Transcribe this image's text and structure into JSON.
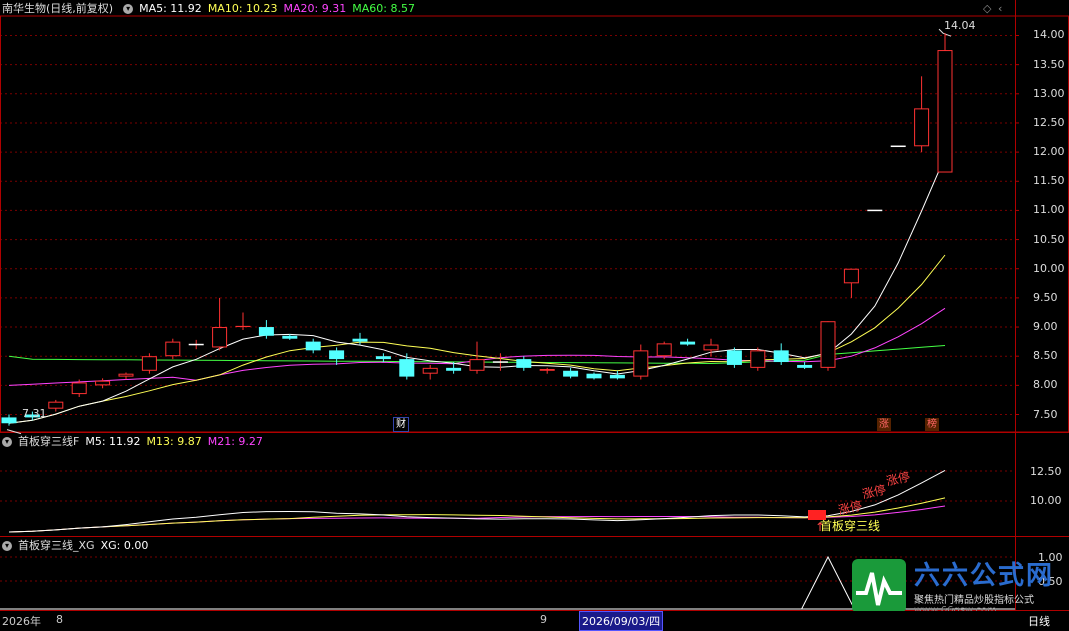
{
  "main_panel": {
    "stock_name": "南华生物(日线,前复权)",
    "indicators": [
      {
        "label": "MA5: 11.92",
        "color": "#ffffff"
      },
      {
        "label": "MA10: 10.23",
        "color": "#ffff55"
      },
      {
        "label": "MA20: 9.31",
        "color": "#ff44ff"
      },
      {
        "label": "MA60: 8.57",
        "color": "#44ff44"
      }
    ],
    "y_ticks": [
      "14.00",
      "13.50",
      "13.00",
      "12.50",
      "12.00",
      "11.50",
      "11.00",
      "10.50",
      "10.00",
      "9.50",
      "9.00",
      "8.50",
      "8.00",
      "7.50"
    ],
    "high_label": "14.04",
    "low_label": "7.31",
    "markers": [
      {
        "text": "财",
        "color": "#ffffff"
      },
      {
        "text": "涨",
        "color": "#ff6666"
      },
      {
        "text": "榜",
        "color": "#ff6666"
      }
    ]
  },
  "panel2": {
    "title": "首板穿三线F",
    "indicators": [
      {
        "label": "M5: 11.92",
        "color": "#ffffff"
      },
      {
        "label": "M13: 9.87",
        "color": "#ffff55"
      },
      {
        "label": "M21: 9.27",
        "color": "#ff44ff"
      }
    ],
    "y_ticks": [
      "12.50",
      "10.00"
    ],
    "annotations": [
      "涨停",
      "涨停",
      "涨停"
    ],
    "signal_label": "首板穿三线"
  },
  "panel3": {
    "title": "首板穿三线_XG",
    "indicators": [
      {
        "label": "XG: 0.00",
        "color": "#ffffff"
      }
    ],
    "y_ticks": [
      "1.00",
      "0.50"
    ]
  },
  "bottom": {
    "year": "2026年",
    "month1": "8",
    "month2": "9",
    "cursor_date": "2026/09/03/四",
    "period": "日线"
  },
  "logo": {
    "name": "六六公式网",
    "slogan": "聚焦热门精品炒股指标公式",
    "url": "www.66gsw.com"
  },
  "colors": {
    "up": "#ff3232",
    "down": "#54ffff",
    "grid": "#7a0000",
    "frame": "#b00000"
  },
  "chart_data": {
    "type": "candlestick",
    "ylim": [
      7.2,
      14.3
    ],
    "candles": [
      {
        "o": 7.45,
        "h": 7.5,
        "l": 7.31,
        "c": 7.35
      },
      {
        "o": 7.5,
        "h": 7.55,
        "l": 7.4,
        "c": 7.45
      },
      {
        "o": 7.6,
        "h": 7.75,
        "l": 7.55,
        "c": 7.72
      },
      {
        "o": 7.85,
        "h": 8.1,
        "l": 7.8,
        "c": 8.05
      },
      {
        "o": 8.0,
        "h": 8.12,
        "l": 7.95,
        "c": 8.08
      },
      {
        "o": 8.15,
        "h": 8.22,
        "l": 8.1,
        "c": 8.2
      },
      {
        "o": 8.25,
        "h": 8.55,
        "l": 8.2,
        "c": 8.5
      },
      {
        "o": 8.5,
        "h": 8.8,
        "l": 8.45,
        "c": 8.75
      },
      {
        "o": 8.7,
        "h": 8.78,
        "l": 8.62,
        "c": 8.7
      },
      {
        "o": 8.65,
        "h": 9.5,
        "l": 8.6,
        "c": 9.0
      },
      {
        "o": 9.0,
        "h": 9.25,
        "l": 8.95,
        "c": 9.02
      },
      {
        "o": 9.0,
        "h": 9.12,
        "l": 8.8,
        "c": 8.85
      },
      {
        "o": 8.85,
        "h": 8.88,
        "l": 8.78,
        "c": 8.8
      },
      {
        "o": 8.75,
        "h": 8.8,
        "l": 8.55,
        "c": 8.6
      },
      {
        "o": 8.6,
        "h": 8.65,
        "l": 8.35,
        "c": 8.45
      },
      {
        "o": 8.8,
        "h": 8.9,
        "l": 8.7,
        "c": 8.75
      },
      {
        "o": 8.5,
        "h": 8.55,
        "l": 8.4,
        "c": 8.45
      },
      {
        "o": 8.45,
        "h": 8.55,
        "l": 8.1,
        "c": 8.15
      },
      {
        "o": 8.2,
        "h": 8.35,
        "l": 8.1,
        "c": 8.3
      },
      {
        "o": 8.3,
        "h": 8.4,
        "l": 8.2,
        "c": 8.25
      },
      {
        "o": 8.25,
        "h": 8.75,
        "l": 8.2,
        "c": 8.45
      },
      {
        "o": 8.4,
        "h": 8.55,
        "l": 8.25,
        "c": 8.4
      },
      {
        "o": 8.45,
        "h": 8.5,
        "l": 8.25,
        "c": 8.3
      },
      {
        "o": 8.25,
        "h": 8.3,
        "l": 8.2,
        "c": 8.28
      },
      {
        "o": 8.25,
        "h": 8.3,
        "l": 8.12,
        "c": 8.15
      },
      {
        "o": 8.2,
        "h": 8.22,
        "l": 8.1,
        "c": 8.12
      },
      {
        "o": 8.18,
        "h": 8.25,
        "l": 8.1,
        "c": 8.12
      },
      {
        "o": 8.15,
        "h": 8.7,
        "l": 8.1,
        "c": 8.6
      },
      {
        "o": 8.5,
        "h": 8.75,
        "l": 8.45,
        "c": 8.72
      },
      {
        "o": 8.75,
        "h": 8.8,
        "l": 8.68,
        "c": 8.7
      },
      {
        "o": 8.6,
        "h": 8.8,
        "l": 8.5,
        "c": 8.7
      },
      {
        "o": 8.6,
        "h": 8.65,
        "l": 8.3,
        "c": 8.35
      },
      {
        "o": 8.3,
        "h": 8.65,
        "l": 8.25,
        "c": 8.6
      },
      {
        "o": 8.6,
        "h": 8.72,
        "l": 8.35,
        "c": 8.4
      },
      {
        "o": 8.35,
        "h": 8.4,
        "l": 8.28,
        "c": 8.3
      },
      {
        "o": 8.3,
        "h": 9.1,
        "l": 8.25,
        "c": 9.1
      },
      {
        "o": 9.75,
        "h": 10.0,
        "l": 9.5,
        "c": 10.0
      },
      {
        "o": 11.0,
        "h": 11.0,
        "l": 11.0,
        "c": 11.0
      },
      {
        "o": 12.1,
        "h": 12.1,
        "l": 12.1,
        "c": 12.1
      },
      {
        "o": 12.1,
        "h": 13.3,
        "l": 12.0,
        "c": 12.75
      },
      {
        "o": 11.65,
        "h": 14.04,
        "l": 11.65,
        "c": 13.75
      }
    ]
  }
}
